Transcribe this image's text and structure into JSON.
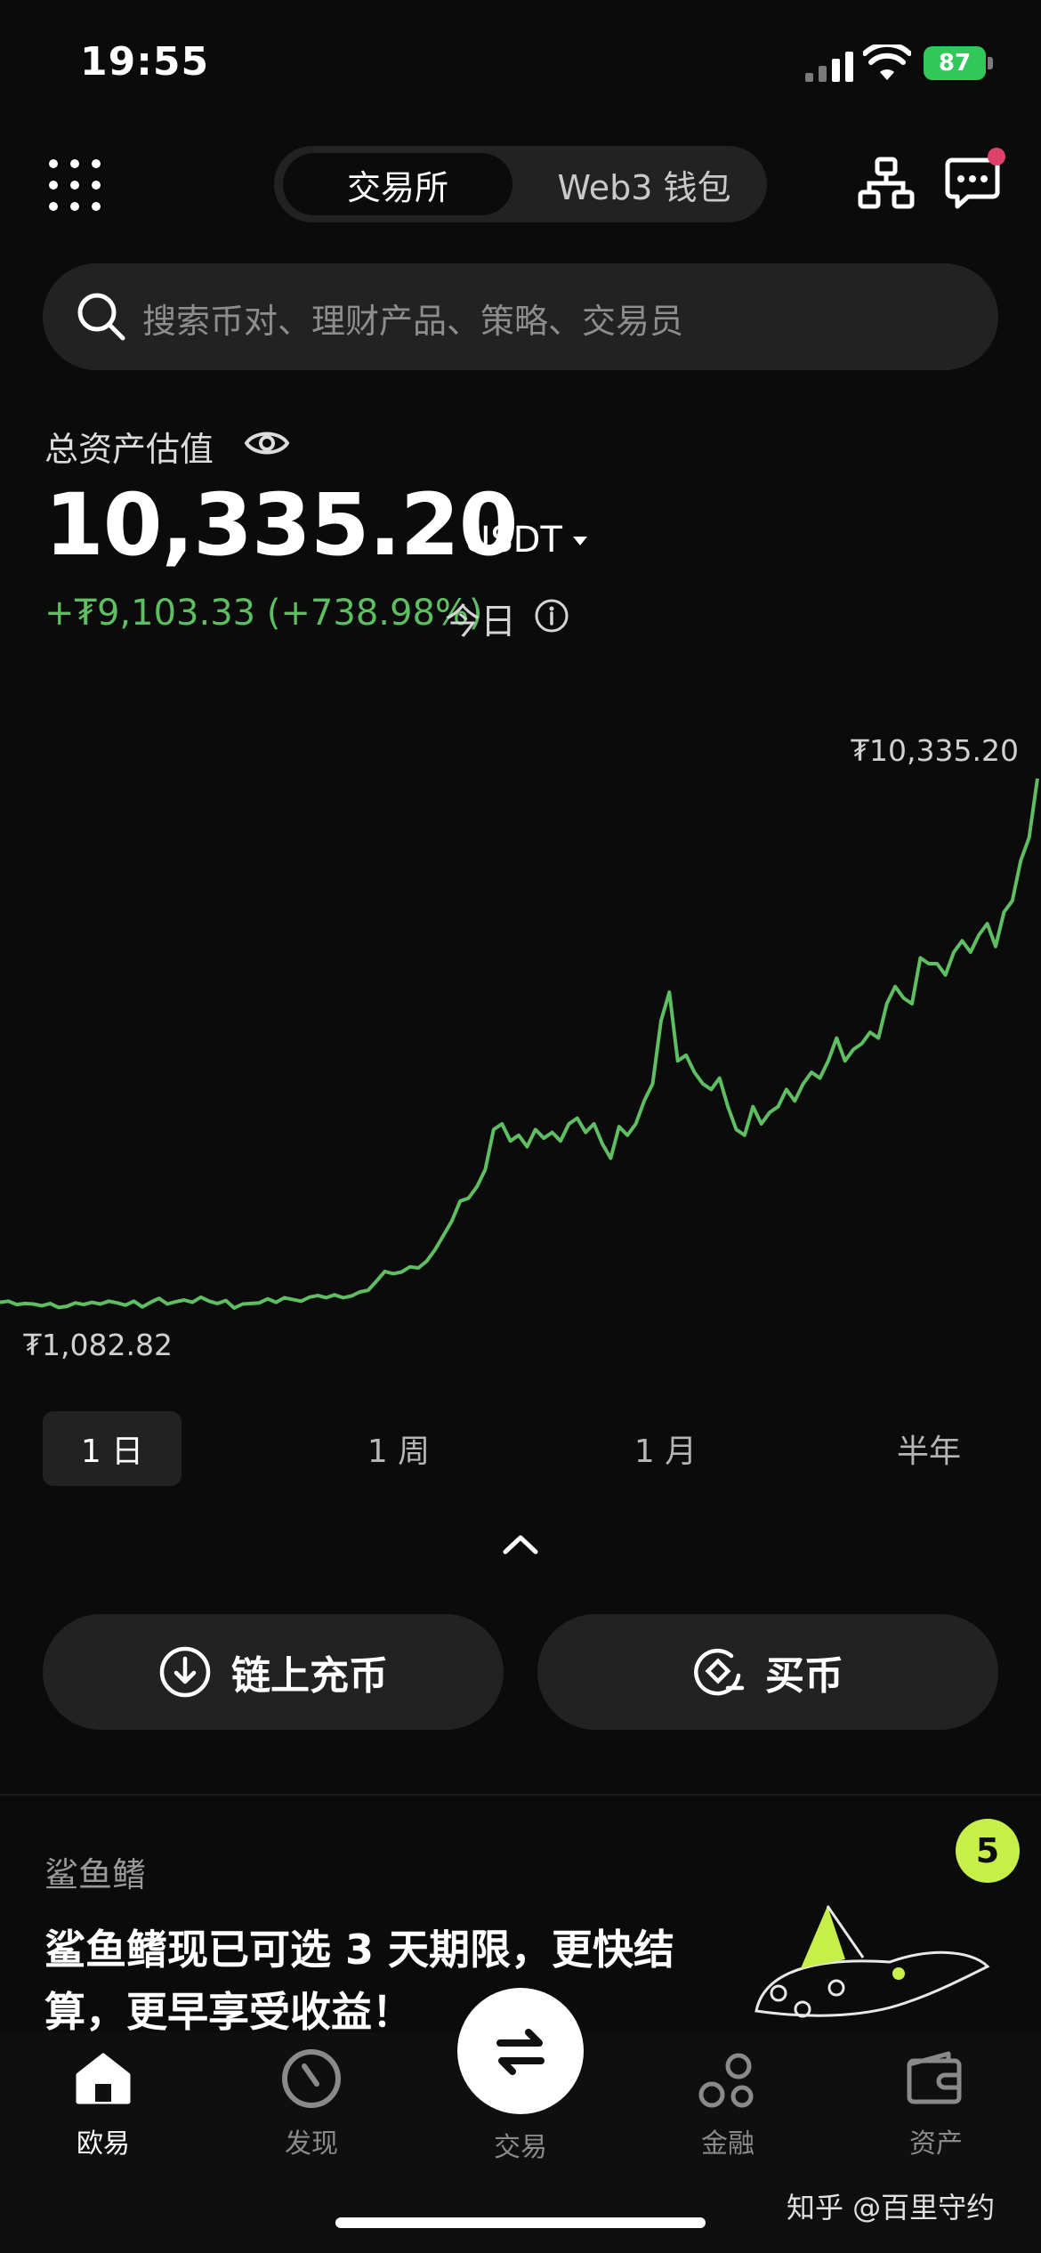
{
  "status_bar": {
    "time": "19:55",
    "battery": "87"
  },
  "header": {
    "tabs": [
      "交易所",
      "Web3 钱包"
    ]
  },
  "search": {
    "placeholder": "搜索币对、理财产品、策略、交易员"
  },
  "asset": {
    "label": "总资产估值",
    "value": "10,335.20",
    "unit": "USDT",
    "change": "+₮9,103.33 (+738.98%)",
    "period": "今日"
  },
  "chart_data": {
    "type": "line",
    "max_label": "₮10,335.20",
    "min_label": "₮1,082.82",
    "series": [
      {
        "values": [
          1180,
          1200,
          1140,
          1160,
          1150,
          1120,
          1160,
          1090,
          1110,
          1170,
          1140,
          1180,
          1150,
          1200,
          1170,
          1130,
          1200,
          1100,
          1180,
          1250,
          1150,
          1190,
          1220,
          1180,
          1270,
          1200,
          1160,
          1210,
          1080,
          1150,
          1160,
          1170,
          1240,
          1180,
          1260,
          1230,
          1200,
          1270,
          1300,
          1260,
          1310,
          1260,
          1290,
          1360,
          1390,
          1550,
          1720,
          1680,
          1710,
          1800,
          1780,
          1900,
          2100,
          2350,
          2600,
          2950,
          3000,
          3200,
          3500,
          4200,
          4300,
          4000,
          4100,
          3900,
          4200,
          4050,
          4150,
          4000,
          4300,
          4400,
          4150,
          4300,
          3950,
          3700,
          4250,
          4100,
          4300,
          4700,
          5000,
          6100,
          6600,
          5400,
          5500,
          5200,
          5000,
          4900,
          5100,
          4600,
          4200,
          4100,
          4600,
          4300,
          4500,
          4600,
          4900,
          4700,
          5000,
          5200,
          5100,
          5400,
          5800,
          5400,
          5600,
          5700,
          5900,
          5800,
          6400,
          6700,
          6500,
          6400,
          7200,
          7100,
          7100,
          6900,
          7300,
          7500,
          7300,
          7600,
          7800,
          7400,
          8000,
          8200,
          8900,
          9300,
          10335
        ]
      }
    ]
  },
  "ranges": [
    "1 日",
    "1 周",
    "1 月",
    "半年"
  ],
  "actions": {
    "deposit": "链上充币",
    "buy": "买币"
  },
  "promo": {
    "title": "鲨鱼鳍",
    "badge": "5",
    "text": "鲨鱼鳍现已可选 3 天期限，更快结算，更早享受收益！"
  },
  "nav": {
    "home": "欧易",
    "discover": "发现",
    "trade": "交易",
    "finance": "金融",
    "assets": "资产"
  },
  "watermark": "知乎 @百里守约",
  "colors": {
    "accent_green": "#5fbe62",
    "badge_lime": "#c6f049",
    "notification": "#e0416b"
  }
}
